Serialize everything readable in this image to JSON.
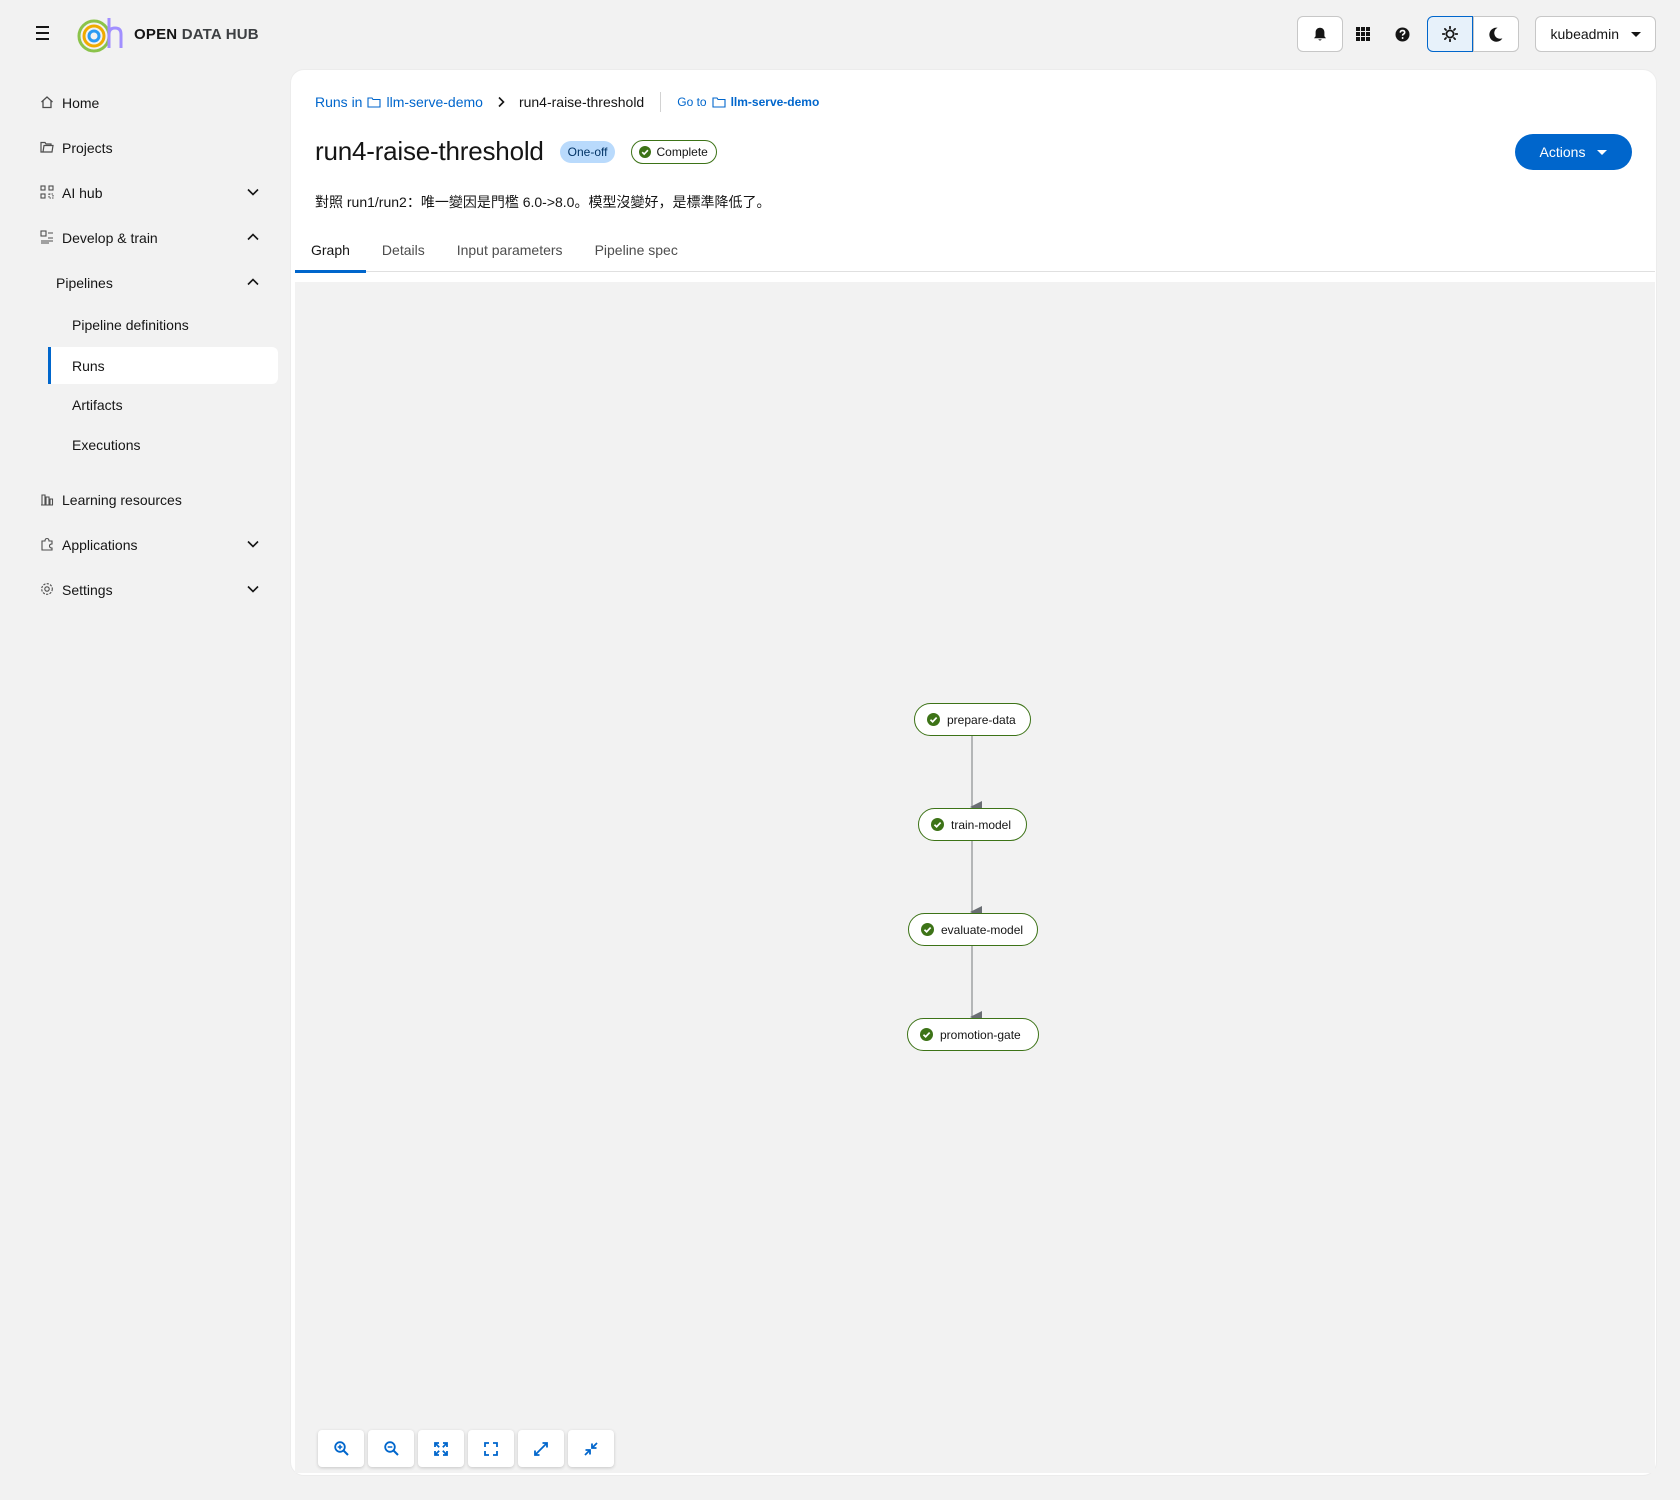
{
  "masthead": {
    "logo_text_bold": "OPEN",
    "logo_text_rest": "DATA HUB",
    "user_label": "kubeadmin",
    "icons": [
      "menu-icon",
      "bell-icon",
      "grid-icon",
      "help-icon",
      "sun-icon",
      "moon-icon"
    ]
  },
  "sidebar": {
    "home": "Home",
    "projects": "Projects",
    "ai_hub": "AI hub",
    "develop_train": "Develop & train",
    "pipelines": "Pipelines",
    "pipeline_definitions": "Pipeline definitions",
    "runs": "Runs",
    "artifacts": "Artifacts",
    "executions": "Executions",
    "learning_resources": "Learning resources",
    "applications": "Applications",
    "settings": "Settings"
  },
  "breadcrumb": {
    "runs_in": "Runs in",
    "project": "llm-serve-demo",
    "current": "run4-raise-threshold",
    "goto_prefix": "Go to",
    "goto_project": "llm-serve-demo"
  },
  "run": {
    "title": "run4-raise-threshold",
    "type_label": "One-off",
    "status_label": "Complete",
    "description": "對照 run1/run2：唯一變因是門檻 6.0->8.0。模型沒變好，是標準降低了。",
    "actions_label": "Actions"
  },
  "tabs": [
    "Graph",
    "Details",
    "Input parameters",
    "Pipeline spec"
  ],
  "active_tab": "Graph",
  "graph": {
    "nodes": [
      {
        "name": "prepare-data",
        "status": "succeeded"
      },
      {
        "name": "train-model",
        "status": "succeeded"
      },
      {
        "name": "evaluate-model",
        "status": "succeeded"
      },
      {
        "name": "promotion-gate",
        "status": "succeeded"
      }
    ],
    "edges": [
      [
        "prepare-data",
        "train-model"
      ],
      [
        "train-model",
        "evaluate-model"
      ],
      [
        "evaluate-model",
        "promotion-gate"
      ]
    ]
  },
  "colors": {
    "accent": "#0066cc",
    "success": "#3d7317",
    "one_off_badge": "#b9dafc"
  }
}
